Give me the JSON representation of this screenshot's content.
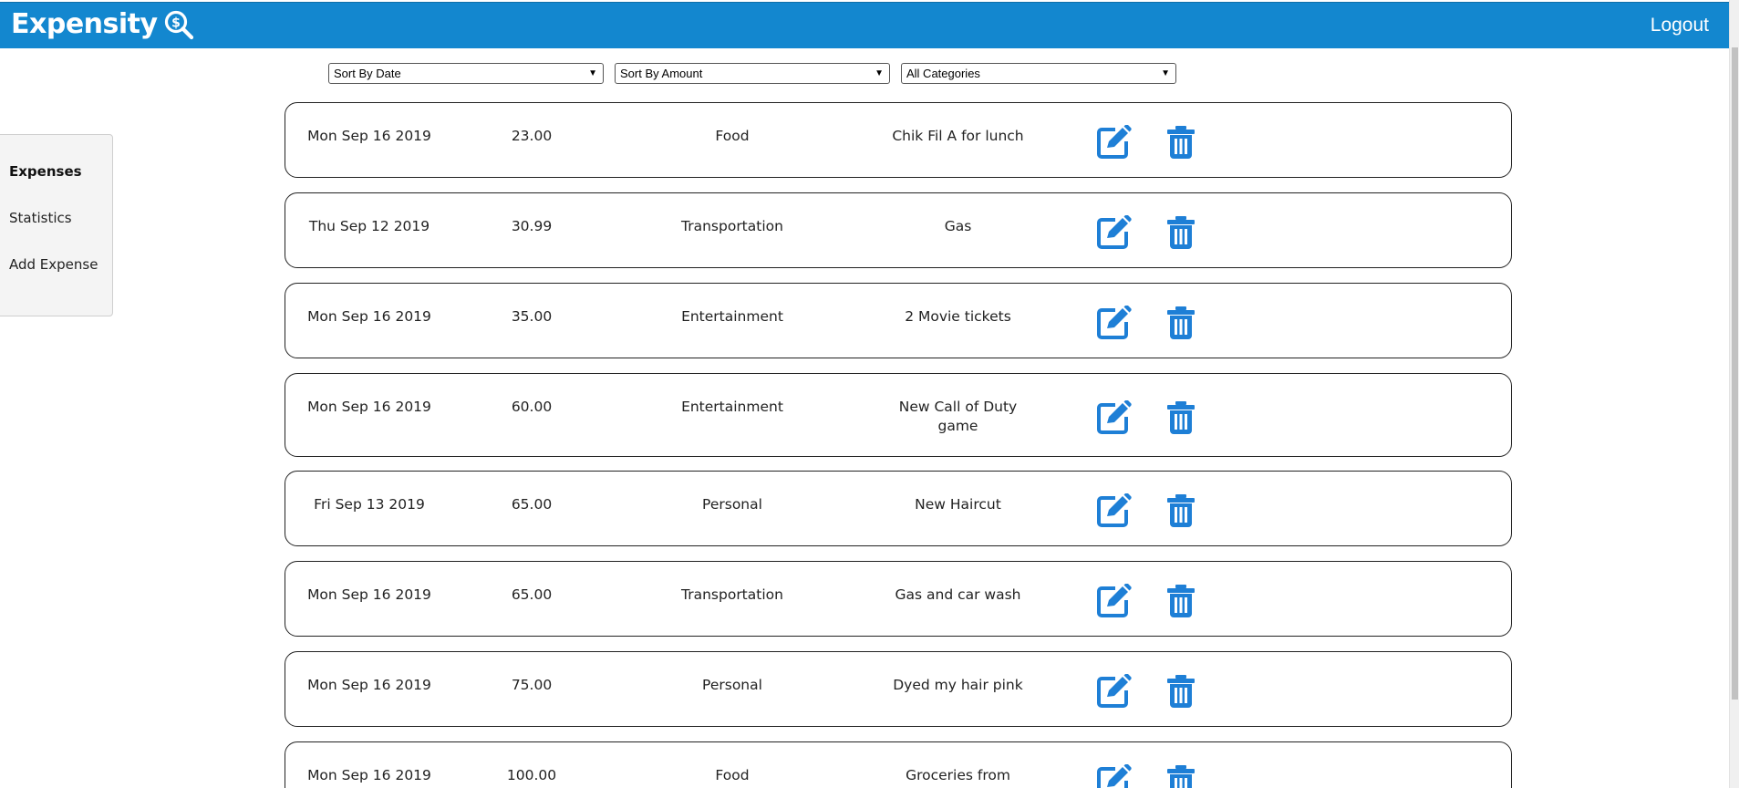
{
  "header": {
    "brand": "Expensity",
    "brand_icon": "dollar-search-icon",
    "logout_label": "Logout",
    "bar_color": "#1387cf"
  },
  "filters": {
    "sort_date": "Sort By Date",
    "sort_amount": "Sort By Amount",
    "category": "All Categories"
  },
  "sidebar": {
    "items": [
      {
        "label": "Expenses",
        "active": true
      },
      {
        "label": "Statistics",
        "active": false
      },
      {
        "label": "Add Expense",
        "active": false
      }
    ]
  },
  "expenses": [
    {
      "date": "Mon Sep 16 2019",
      "amount": "23.00",
      "category": "Food",
      "note": "Chik Fil A for lunch"
    },
    {
      "date": "Thu Sep 12 2019",
      "amount": "30.99",
      "category": "Transportation",
      "note": "Gas"
    },
    {
      "date": "Mon Sep 16 2019",
      "amount": "35.00",
      "category": "Entertainment",
      "note": "2 Movie tickets"
    },
    {
      "date": "Mon Sep 16 2019",
      "amount": "60.00",
      "category": "Entertainment",
      "note": "New Call of Duty game"
    },
    {
      "date": "Fri Sep 13 2019",
      "amount": "65.00",
      "category": "Personal",
      "note": "New Haircut"
    },
    {
      "date": "Mon Sep 16 2019",
      "amount": "65.00",
      "category": "Transportation",
      "note": "Gas and car wash"
    },
    {
      "date": "Mon Sep 16 2019",
      "amount": "75.00",
      "category": "Personal",
      "note": "Dyed my hair pink"
    },
    {
      "date": "Mon Sep 16 2019",
      "amount": "100.00",
      "category": "Food",
      "note": "Groceries from Publix"
    }
  ],
  "icons": {
    "edit": "edit-icon",
    "delete": "trash-icon",
    "accent": "#1e7fd6"
  }
}
